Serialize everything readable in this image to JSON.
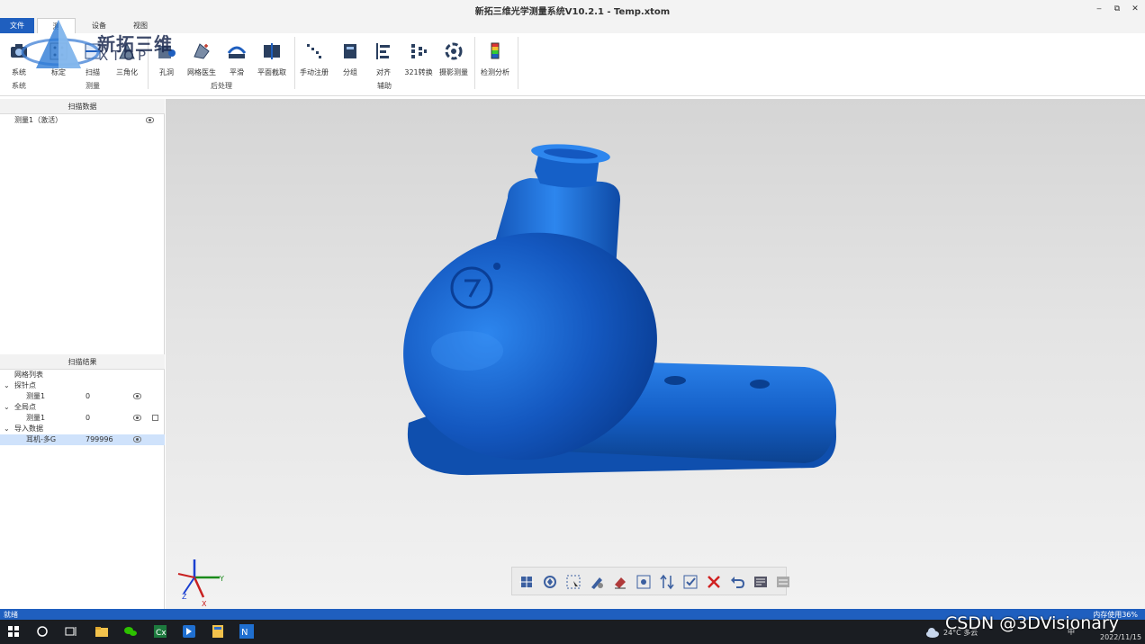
{
  "window": {
    "title": "新拓三维光学测量系统V10.2.1 - Temp.xtom",
    "minimize": "‒",
    "restore": "⧉",
    "close": "✕"
  },
  "menu": {
    "file": "文件",
    "active_tab": "测",
    "device": "设备",
    "view": "视图"
  },
  "logo": {
    "cn": "新拓三维",
    "en": "XTOP"
  },
  "ribbon": {
    "buttons": [
      {
        "label": "系统",
        "icon": "camera-icon"
      },
      {
        "label": "标定",
        "icon": "calibrate-icon"
      },
      {
        "label": "扫描",
        "icon": "scan-icon"
      },
      {
        "label": "三角化",
        "icon": "triangulate-icon"
      },
      {
        "label": "孔洞",
        "icon": "hole-icon"
      },
      {
        "label": "网格医生",
        "icon": "mesh-doctor-icon"
      },
      {
        "label": "平滑",
        "icon": "smooth-icon"
      },
      {
        "label": "平面截取",
        "icon": "plane-cut-icon"
      },
      {
        "label": "手动注册",
        "icon": "manual-register-icon"
      },
      {
        "label": "分组",
        "icon": "group-icon"
      },
      {
        "label": "对齐",
        "icon": "align-icon"
      },
      {
        "label": "321转换",
        "icon": "transform-321-icon"
      },
      {
        "label": "摄影测量",
        "icon": "photogrammetry-icon"
      },
      {
        "label": "检测分析",
        "icon": "inspection-icon"
      }
    ],
    "groups": {
      "system": "系统",
      "measure": "测量",
      "post": "后处理",
      "aux": "辅助"
    }
  },
  "scan_data": {
    "header": "扫描数据",
    "items": [
      {
        "label": "测量1（激活）"
      }
    ]
  },
  "scan_results": {
    "header": "扫描结果",
    "mesh_list": "网格列表",
    "probe_points": "探针点",
    "probe_child": {
      "name": "测量1",
      "count": "0"
    },
    "global_points": "全局点",
    "global_child": {
      "name": "测量1",
      "count": "0"
    },
    "import_data": "导入数据",
    "import_child": {
      "name": "耳机-多G",
      "count": "799996"
    }
  },
  "axis": {
    "x": "X",
    "y": "Y",
    "z": "Z"
  },
  "status": {
    "left": "就绪",
    "right": "内存使用36%"
  },
  "taskbar": {
    "weather": "24°C 多云",
    "time": "",
    "date": "2022/11/15",
    "ime": "中",
    "watermark": "CSDN @3DVisionary"
  },
  "colors": {
    "accent": "#1f5fbf",
    "model": "#1560c8",
    "statusbar": "#1f5fbf"
  }
}
